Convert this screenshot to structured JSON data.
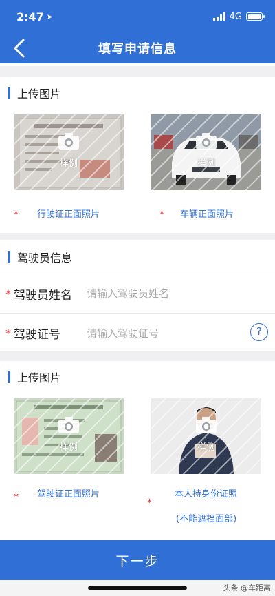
{
  "status_bar": {
    "time": "2:47",
    "network": "4G"
  },
  "nav": {
    "title": "填写申请信息"
  },
  "vehicle_upload": {
    "title": "上传图片",
    "photos": [
      {
        "caption": "行驶证正面照片",
        "sample_label": "样例"
      },
      {
        "caption": "车辆正面照片",
        "sample_label": "样例"
      }
    ]
  },
  "driver_info": {
    "title": "驾驶员信息",
    "fields": [
      {
        "label": "驾驶员姓名",
        "placeholder": "请输入驾驶员姓名",
        "value": ""
      },
      {
        "label": "驾驶证号",
        "placeholder": "请输入驾驶证号",
        "value": ""
      }
    ],
    "help_glyph": "?"
  },
  "driver_upload": {
    "title": "上传图片",
    "photos": [
      {
        "caption": "驾驶证正面照片",
        "sample_label": "样例"
      },
      {
        "caption": "本人持身份证照",
        "caption_line2": "(不能遮挡面部)",
        "sample_label": "样例"
      }
    ]
  },
  "required_mark": "*",
  "footer": {
    "next_label": "下一步"
  },
  "watermark": "头条 @车距离",
  "colors": {
    "primary": "#2f6fd6",
    "required": "#e43b3b"
  }
}
